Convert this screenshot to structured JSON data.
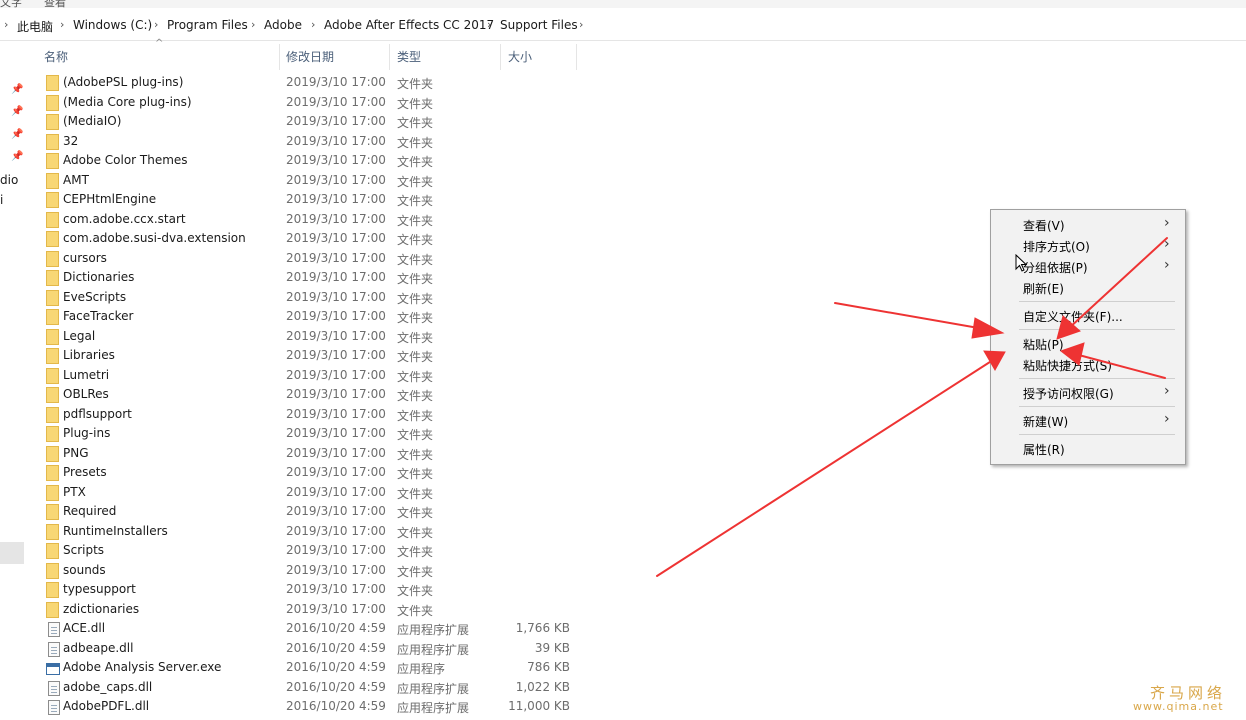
{
  "ribbon": {
    "items": [
      "文字",
      "查看"
    ]
  },
  "address": {
    "crumbs": [
      "此电脑",
      "Windows (C:)",
      "Program Files",
      "Adobe",
      "Adobe After Effects CC 2017",
      "Support Files"
    ]
  },
  "nav": {
    "partial_labels": [
      "dio",
      "i"
    ]
  },
  "columns": {
    "name": "名称",
    "date": "修改日期",
    "type": "类型",
    "size": "大小"
  },
  "files": [
    {
      "name": "(AdobePSL plug-ins)",
      "date": "2019/3/10 17:00",
      "type": "文件夹",
      "size": "",
      "icon": "folder-icon"
    },
    {
      "name": "(Media Core plug-ins)",
      "date": "2019/3/10 17:00",
      "type": "文件夹",
      "size": "",
      "icon": "folder-icon"
    },
    {
      "name": "(MediaIO)",
      "date": "2019/3/10 17:00",
      "type": "文件夹",
      "size": "",
      "icon": "folder-icon"
    },
    {
      "name": "32",
      "date": "2019/3/10 17:00",
      "type": "文件夹",
      "size": "",
      "icon": "folder-icon"
    },
    {
      "name": "Adobe Color Themes",
      "date": "2019/3/10 17:00",
      "type": "文件夹",
      "size": "",
      "icon": "folder-icon"
    },
    {
      "name": "AMT",
      "date": "2019/3/10 17:00",
      "type": "文件夹",
      "size": "",
      "icon": "folder-icon"
    },
    {
      "name": "CEPHtmlEngine",
      "date": "2019/3/10 17:00",
      "type": "文件夹",
      "size": "",
      "icon": "folder-icon"
    },
    {
      "name": "com.adobe.ccx.start",
      "date": "2019/3/10 17:00",
      "type": "文件夹",
      "size": "",
      "icon": "folder-icon"
    },
    {
      "name": "com.adobe.susi-dva.extension",
      "date": "2019/3/10 17:00",
      "type": "文件夹",
      "size": "",
      "icon": "folder-icon"
    },
    {
      "name": "cursors",
      "date": "2019/3/10 17:00",
      "type": "文件夹",
      "size": "",
      "icon": "folder-icon"
    },
    {
      "name": "Dictionaries",
      "date": "2019/3/10 17:00",
      "type": "文件夹",
      "size": "",
      "icon": "folder-icon"
    },
    {
      "name": "EveScripts",
      "date": "2019/3/10 17:00",
      "type": "文件夹",
      "size": "",
      "icon": "folder-icon"
    },
    {
      "name": "FaceTracker",
      "date": "2019/3/10 17:00",
      "type": "文件夹",
      "size": "",
      "icon": "folder-icon"
    },
    {
      "name": "Legal",
      "date": "2019/3/10 17:00",
      "type": "文件夹",
      "size": "",
      "icon": "folder-icon"
    },
    {
      "name": "Libraries",
      "date": "2019/3/10 17:00",
      "type": "文件夹",
      "size": "",
      "icon": "folder-icon"
    },
    {
      "name": "Lumetri",
      "date": "2019/3/10 17:00",
      "type": "文件夹",
      "size": "",
      "icon": "folder-icon"
    },
    {
      "name": "OBLRes",
      "date": "2019/3/10 17:00",
      "type": "文件夹",
      "size": "",
      "icon": "folder-icon"
    },
    {
      "name": "pdflsupport",
      "date": "2019/3/10 17:00",
      "type": "文件夹",
      "size": "",
      "icon": "folder-icon"
    },
    {
      "name": "Plug-ins",
      "date": "2019/3/10 17:00",
      "type": "文件夹",
      "size": "",
      "icon": "folder-icon"
    },
    {
      "name": "PNG",
      "date": "2019/3/10 17:00",
      "type": "文件夹",
      "size": "",
      "icon": "folder-icon"
    },
    {
      "name": "Presets",
      "date": "2019/3/10 17:00",
      "type": "文件夹",
      "size": "",
      "icon": "folder-icon"
    },
    {
      "name": "PTX",
      "date": "2019/3/10 17:00",
      "type": "文件夹",
      "size": "",
      "icon": "folder-icon"
    },
    {
      "name": "Required",
      "date": "2019/3/10 17:00",
      "type": "文件夹",
      "size": "",
      "icon": "folder-icon"
    },
    {
      "name": "RuntimeInstallers",
      "date": "2019/3/10 17:00",
      "type": "文件夹",
      "size": "",
      "icon": "folder-icon"
    },
    {
      "name": "Scripts",
      "date": "2019/3/10 17:00",
      "type": "文件夹",
      "size": "",
      "icon": "folder-icon"
    },
    {
      "name": "sounds",
      "date": "2019/3/10 17:00",
      "type": "文件夹",
      "size": "",
      "icon": "folder-icon"
    },
    {
      "name": "typesupport",
      "date": "2019/3/10 17:00",
      "type": "文件夹",
      "size": "",
      "icon": "folder-icon"
    },
    {
      "name": "zdictionaries",
      "date": "2019/3/10 17:00",
      "type": "文件夹",
      "size": "",
      "icon": "folder-icon"
    },
    {
      "name": "ACE.dll",
      "date": "2016/10/20 4:59",
      "type": "应用程序扩展",
      "size": "1,766 KB",
      "icon": "file-icon"
    },
    {
      "name": "adbeape.dll",
      "date": "2016/10/20 4:59",
      "type": "应用程序扩展",
      "size": "39 KB",
      "icon": "file-icon"
    },
    {
      "name": "Adobe Analysis Server.exe",
      "date": "2016/10/20 4:59",
      "type": "应用程序",
      "size": "786 KB",
      "icon": "exe-icon"
    },
    {
      "name": "adobe_caps.dll",
      "date": "2016/10/20 4:59",
      "type": "应用程序扩展",
      "size": "1,022 KB",
      "icon": "file-icon"
    },
    {
      "name": "AdobePDFL.dll",
      "date": "2016/10/20 4:59",
      "type": "应用程序扩展",
      "size": "11,000 KB",
      "icon": "file-icon"
    }
  ],
  "context_menu": {
    "view": "查看(V)",
    "sort": "排序方式(O)",
    "group": "分组依据(P)",
    "refresh": "刷新(E)",
    "customize": "自定义文件夹(F)...",
    "paste": "粘贴(P)",
    "paste_shortcut": "粘贴快捷方式(S)",
    "give_access": "授予访问权限(G)",
    "new": "新建(W)",
    "properties": "属性(R)"
  },
  "annotation_color": "#ee3333",
  "watermark": {
    "line1": "齐马网络",
    "line2": "www.qima.net"
  }
}
